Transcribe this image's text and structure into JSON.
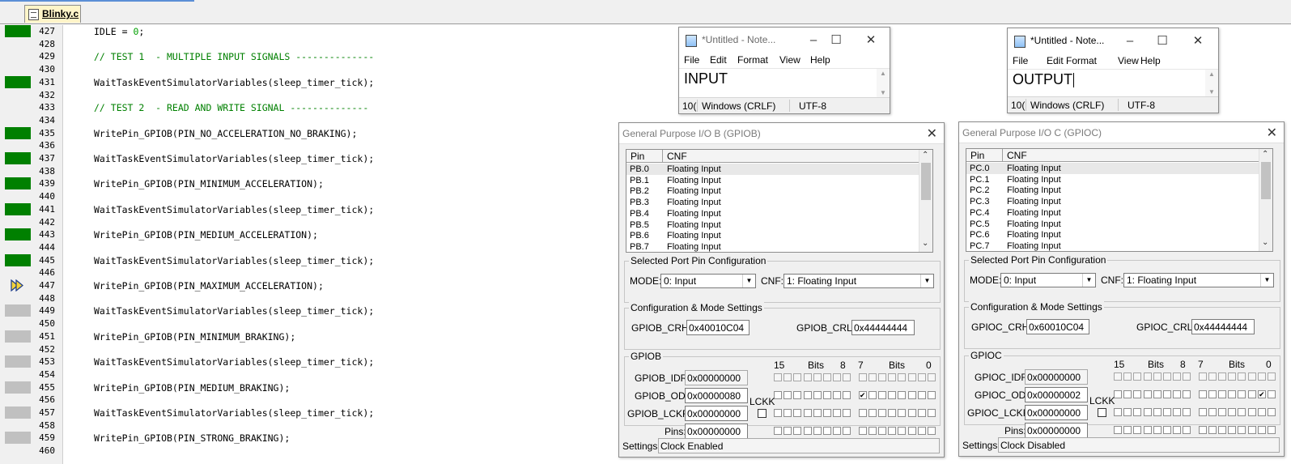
{
  "editor": {
    "tab_label": "Blinky.c",
    "lines": [
      {
        "n": "427",
        "text": "IDLE = ",
        "num": "0",
        "tail": ";",
        "mark": "green",
        "comment": false
      },
      {
        "n": "428",
        "text": "",
        "mark": "none",
        "comment": false
      },
      {
        "n": "429",
        "text": "// TEST 1  - MULTIPLE INPUT SIGNALS --------------",
        "mark": "none",
        "comment": true
      },
      {
        "n": "430",
        "text": "",
        "mark": "none",
        "comment": false
      },
      {
        "n": "431",
        "text": "WaitTaskEventSimulatorVariables(sleep_timer_tick);",
        "mark": "green",
        "comment": false
      },
      {
        "n": "432",
        "text": "",
        "mark": "none",
        "comment": false
      },
      {
        "n": "433",
        "text": "// TEST 2  - READ AND WRITE SIGNAL --------------",
        "mark": "none",
        "comment": true
      },
      {
        "n": "434",
        "text": "",
        "mark": "none",
        "comment": false
      },
      {
        "n": "435",
        "text": "WritePin_GPIOB(PIN_NO_ACCELERATION_NO_BRAKING);",
        "mark": "green",
        "comment": false
      },
      {
        "n": "436",
        "text": "",
        "mark": "none",
        "comment": false
      },
      {
        "n": "437",
        "text": "WaitTaskEventSimulatorVariables(sleep_timer_tick);",
        "mark": "green",
        "comment": false
      },
      {
        "n": "438",
        "text": "",
        "mark": "none",
        "comment": false
      },
      {
        "n": "439",
        "text": "WritePin_GPIOB(PIN_MINIMUM_ACCELERATION);",
        "mark": "green",
        "comment": false
      },
      {
        "n": "440",
        "text": "",
        "mark": "none",
        "comment": false
      },
      {
        "n": "441",
        "text": "WaitTaskEventSimulatorVariables(sleep_timer_tick);",
        "mark": "green",
        "comment": false
      },
      {
        "n": "442",
        "text": "",
        "mark": "none",
        "comment": false
      },
      {
        "n": "443",
        "text": "WritePin_GPIOB(PIN_MEDIUM_ACCELERATION);",
        "mark": "green",
        "comment": false
      },
      {
        "n": "444",
        "text": "",
        "mark": "none",
        "comment": false
      },
      {
        "n": "445",
        "text": "WaitTaskEventSimulatorVariables(sleep_timer_tick);",
        "mark": "green",
        "comment": false
      },
      {
        "n": "446",
        "text": "",
        "mark": "none",
        "comment": false
      },
      {
        "n": "447",
        "text": "WritePin_GPIOB(PIN_MAXIMUM_ACCELERATION);",
        "mark": "arrow",
        "comment": false
      },
      {
        "n": "448",
        "text": "",
        "mark": "none",
        "comment": false
      },
      {
        "n": "449",
        "text": "WaitTaskEventSimulatorVariables(sleep_timer_tick);",
        "mark": "gray",
        "comment": false
      },
      {
        "n": "450",
        "text": "",
        "mark": "none",
        "comment": false
      },
      {
        "n": "451",
        "text": "WritePin_GPIOB(PIN_MINIMUM_BRAKING);",
        "mark": "gray",
        "comment": false
      },
      {
        "n": "452",
        "text": "",
        "mark": "none",
        "comment": false
      },
      {
        "n": "453",
        "text": "WaitTaskEventSimulatorVariables(sleep_timer_tick);",
        "mark": "gray",
        "comment": false
      },
      {
        "n": "454",
        "text": "",
        "mark": "none",
        "comment": false
      },
      {
        "n": "455",
        "text": "WritePin_GPIOB(PIN_MEDIUM_BRAKING);",
        "mark": "gray",
        "comment": false
      },
      {
        "n": "456",
        "text": "",
        "mark": "none",
        "comment": false
      },
      {
        "n": "457",
        "text": "WaitTaskEventSimulatorVariables(sleep_timer_tick);",
        "mark": "gray",
        "comment": false
      },
      {
        "n": "458",
        "text": "",
        "mark": "none",
        "comment": false
      },
      {
        "n": "459",
        "text": "WritePin_GPIOB(PIN_STRONG_BRAKING);",
        "mark": "gray",
        "comment": false
      },
      {
        "n": "460",
        "text": "",
        "mark": "none",
        "comment": false
      }
    ]
  },
  "colors": {
    "executed_marker": "#008000",
    "pending_marker": "#c0c0c0",
    "comment_text": "#008000",
    "current_line_arrow": "#f2d13a"
  },
  "notepad_input": {
    "title": "*Untitled - Note...",
    "menu": [
      "File",
      "Edit",
      "Format",
      "View",
      "Help"
    ],
    "content": "INPUT",
    "status_zoom": "10(",
    "status_eol": "Windows (CRLF)",
    "status_encoding": "UTF-8"
  },
  "notepad_output": {
    "title": "*Untitled - Note...",
    "menu": [
      "File",
      "Edit",
      "Format",
      "View",
      "Help"
    ],
    "content": "OUTPUT",
    "status_zoom": "10(",
    "status_eol": "Windows (CRLF)",
    "status_encoding": "UTF-8"
  },
  "gpio_b": {
    "title": "General Purpose I/O B (GPIOB)",
    "col_pin": "Pin",
    "col_cnf": "CNF",
    "pins": [
      {
        "pin": "PB.0",
        "cnf": "Floating Input"
      },
      {
        "pin": "PB.1",
        "cnf": "Floating Input"
      },
      {
        "pin": "PB.2",
        "cnf": "Floating Input"
      },
      {
        "pin": "PB.3",
        "cnf": "Floating Input"
      },
      {
        "pin": "PB.4",
        "cnf": "Floating Input"
      },
      {
        "pin": "PB.5",
        "cnf": "Floating Input"
      },
      {
        "pin": "PB.6",
        "cnf": "Floating Input"
      },
      {
        "pin": "PB.7",
        "cnf": "Floating Input"
      }
    ],
    "sel_group": "Selected Port Pin Configuration",
    "mode_label": "MODE:",
    "mode_value": "0: Input",
    "cnf_label": "CNF:",
    "cnf_value": "1: Floating Input",
    "cfg_group": "Configuration & Mode Settings",
    "crh_label": "GPIOB_CRH:",
    "crh_value": "0x40010C04",
    "crl_label": "GPIOB_CRL:",
    "crl_value": "0x44444444",
    "port_group": "GPIOB",
    "bits_15": "15",
    "bits_word": "Bits",
    "bits_8": "8",
    "bits_7": "7",
    "bits_0": "0",
    "idr_label": "GPIOB_IDR:",
    "idr_value": "0x00000000",
    "odr_label": "GPIOB_ODR:",
    "odr_value": "0x00000080",
    "lckr_label": "GPIOB_LCKR:",
    "lckr_value": "0x00000000",
    "pins_label": "Pins:",
    "pins_value": "0x00000000",
    "lckk_label": "LCKK",
    "odr_checked_bit": 7,
    "settings_label": "Settings:",
    "settings_value": "Clock Enabled"
  },
  "gpio_c": {
    "title": "General Purpose I/O C (GPIOC)",
    "col_pin": "Pin",
    "col_cnf": "CNF",
    "pins": [
      {
        "pin": "PC.0",
        "cnf": "Floating Input"
      },
      {
        "pin": "PC.1",
        "cnf": "Floating Input"
      },
      {
        "pin": "PC.2",
        "cnf": "Floating Input"
      },
      {
        "pin": "PC.3",
        "cnf": "Floating Input"
      },
      {
        "pin": "PC.4",
        "cnf": "Floating Input"
      },
      {
        "pin": "PC.5",
        "cnf": "Floating Input"
      },
      {
        "pin": "PC.6",
        "cnf": "Floating Input"
      },
      {
        "pin": "PC.7",
        "cnf": "Floating Input"
      }
    ],
    "sel_group": "Selected Port Pin Configuration",
    "mode_label": "MODE:",
    "mode_value": "0: Input",
    "cnf_label": "CNF:",
    "cnf_value": "1: Floating Input",
    "cfg_group": "Configuration & Mode Settings",
    "crh_label": "GPIOC_CRH:",
    "crh_value": "0x60010C04",
    "crl_label": "GPIOC_CRL:",
    "crl_value": "0x44444444",
    "port_group": "GPIOC",
    "bits_15": "15",
    "bits_word": "Bits",
    "bits_8": "8",
    "bits_7": "7",
    "bits_0": "0",
    "idr_label": "GPIOC_IDR:",
    "idr_value": "0x00000000",
    "odr_label": "GPIOC_ODR:",
    "odr_value": "0x00000002",
    "lckr_label": "GPIOC_LCKR:",
    "lckr_value": "0x00000000",
    "pins_label": "Pins:",
    "pins_value": "0x00000000",
    "lckk_label": "LCKK",
    "odr_checked_bit": 1,
    "settings_label": "Settings:",
    "settings_value": "Clock Disabled"
  }
}
